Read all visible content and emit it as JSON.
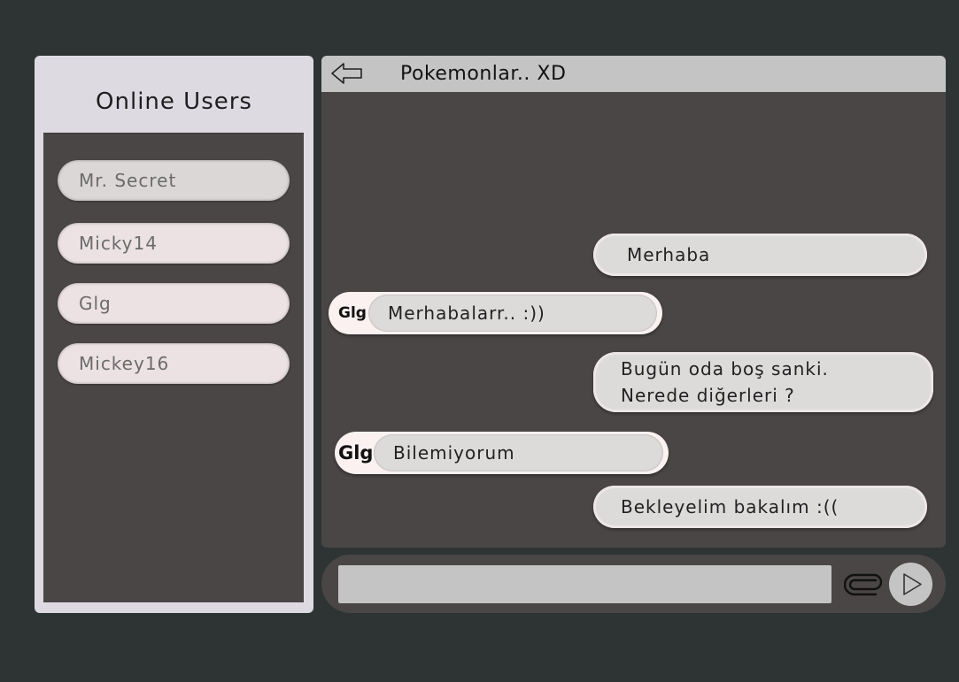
{
  "sidebar": {
    "title": "Online Users",
    "users": [
      "Mr. Secret",
      "Micky14",
      "Glg",
      "Mickey16"
    ]
  },
  "chat": {
    "title": "Pokemonlar.. XD",
    "messages": [
      {
        "direction": "out",
        "lines": [
          "Merhaba"
        ]
      },
      {
        "direction": "in",
        "sender": "Glg",
        "lines": [
          "Merhabalarr.. :))"
        ]
      },
      {
        "direction": "out",
        "lines": [
          "Bugün oda boş sanki.",
          "Nerede diğerleri ?"
        ]
      },
      {
        "direction": "in",
        "sender": "Glg",
        "lines": [
          "Bilemiyorum"
        ]
      },
      {
        "direction": "out",
        "lines": [
          "Bekleyelim bakalım :(("
        ]
      }
    ]
  },
  "composer": {
    "value": "",
    "placeholder": "",
    "attach_icon": "paperclip-icon",
    "send_icon": "play-triangle-icon",
    "back_icon": "arrow-left-icon"
  },
  "colors": {
    "background": "#2e3434",
    "panel": "#4a4646",
    "sidebar": "#dedae2",
    "header": "#c4c4c4",
    "bubble": "#dddada",
    "incoming_frame": "#fbf1f1"
  }
}
